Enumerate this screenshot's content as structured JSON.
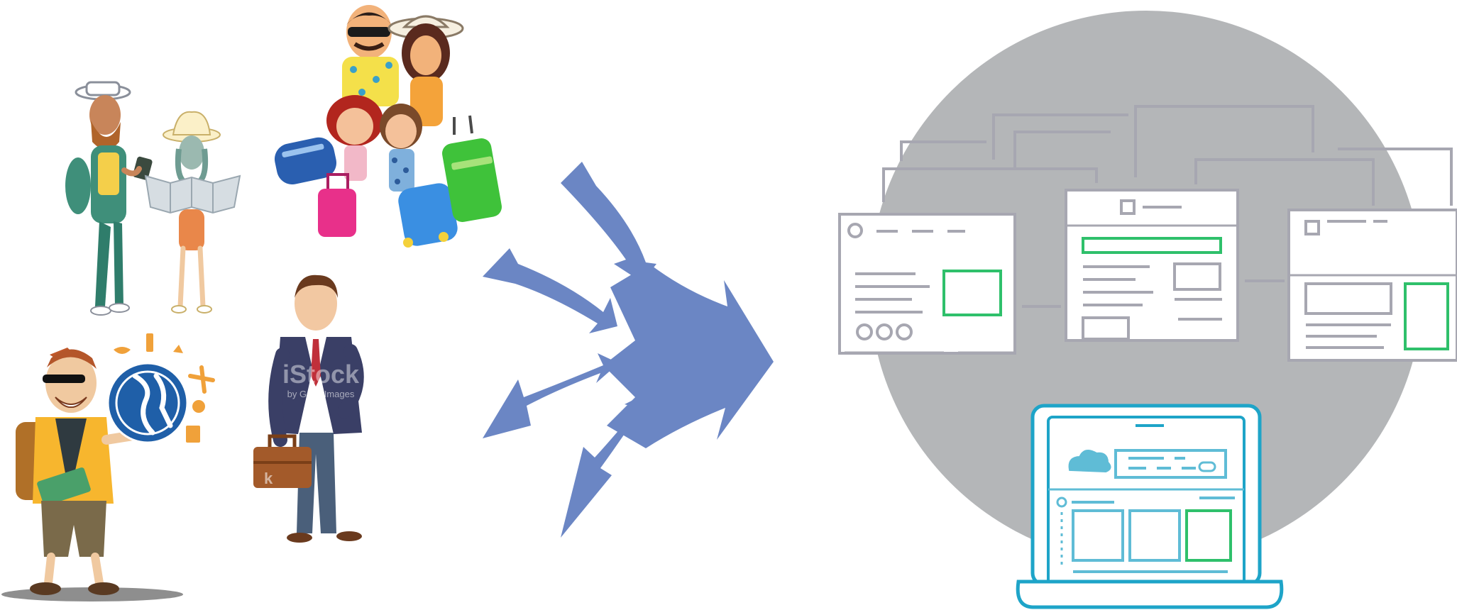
{
  "watermark": {
    "brand": "iStock",
    "credit": "by Getty Images",
    "corner_letter": "k"
  },
  "colors": {
    "background": "#ffffff",
    "arrow_fill": "#6b86c4",
    "circle_fill": "#b4b6b8",
    "window_stroke": "#a7a7b1",
    "accent_green": "#2fc06b",
    "laptop_stroke": "#1ea4c8",
    "laptop_inner": "#5fbcd6",
    "figure_orange": "#f0a13a",
    "globe_blue": "#1f5fa8"
  },
  "icons": [
    "backpacker-couple-figure",
    "family-with-suitcases-figure",
    "traveler-with-globe-figure",
    "businessman-with-briefcase-figure",
    "converging-arrows-icon",
    "browser-window-icon",
    "laptop-icon",
    "cloud-wifi-icon"
  ]
}
